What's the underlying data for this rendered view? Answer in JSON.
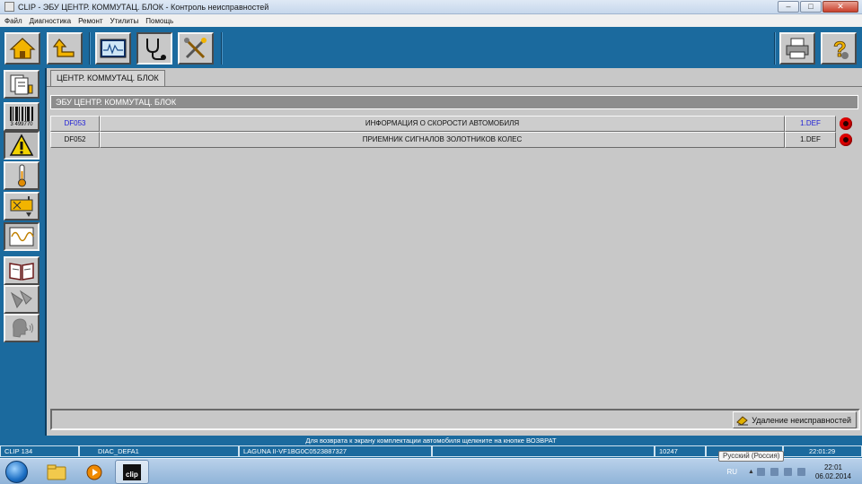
{
  "window": {
    "title": "CLIP - ЭБУ ЦЕНТР. КОММУТАЦ. БЛОК - Контроль неисправностей",
    "minimize": "–",
    "maximize": "□",
    "close": "✕"
  },
  "menu": [
    "Файл",
    "Диагностика",
    "Ремонт",
    "Утилиты",
    "Помощь"
  ],
  "toolbar": {
    "left_icons": [
      "home-icon",
      "back-icon",
      "oscilloscope-icon",
      "stethoscope-icon",
      "tools-icon"
    ],
    "right_icons": [
      "printer-icon",
      "help-icon"
    ],
    "help_glyph": "?"
  },
  "sidebar": {
    "icons": [
      "documents-icon",
      "barcode-icon",
      "warning-icon",
      "thermometer-icon",
      "actuator-icon",
      "signal-graph-icon",
      "manual-book-icon",
      "configuration-icon",
      "voice-icon"
    ],
    "barcode_number": "3 499770"
  },
  "tab": {
    "label": "ЦЕНТР. КОММУТАЦ. БЛОК"
  },
  "ecu_header": "ЭБУ ЦЕНТР. КОММУТАЦ. БЛОК",
  "faults": [
    {
      "code": "DF053",
      "description": "ИНФОРМАЦИЯ О СКОРОСТИ АВТОМОБИЛЯ",
      "status": "1.DEF"
    },
    {
      "code": "DF052",
      "description": "ПРИЕМНИК СИГНАЛОВ ЗОЛОТНИКОВ КОЛЕС",
      "status": "1.DEF"
    }
  ],
  "clear_button": "Удаление неисправностей",
  "hint": "Для возврата к экрану комплектации автомобиля щелкните на кнопке ВОЗВРАТ",
  "status": {
    "device": "CLIP 134",
    "diag": "DIAC_DEFA1",
    "vehicle": "LAGUNA II-VF1BG0C0523887327",
    "empty": "",
    "code": "10247",
    "time": "22:01:29"
  },
  "taskbar": {
    "apps": [
      "explorer-icon",
      "media-player-icon",
      "clip-app-icon"
    ],
    "clip_label": "clip",
    "lang": "RU",
    "lang_tooltip": "Русский (Россия)",
    "clock_time": "22:01",
    "clock_date": "06.02.2014"
  },
  "colors": {
    "frame_blue": "#1b6a9e",
    "panel_gray": "#c8c8c8",
    "code_blue": "#1f1fd6",
    "fault_red": "#e00000"
  }
}
